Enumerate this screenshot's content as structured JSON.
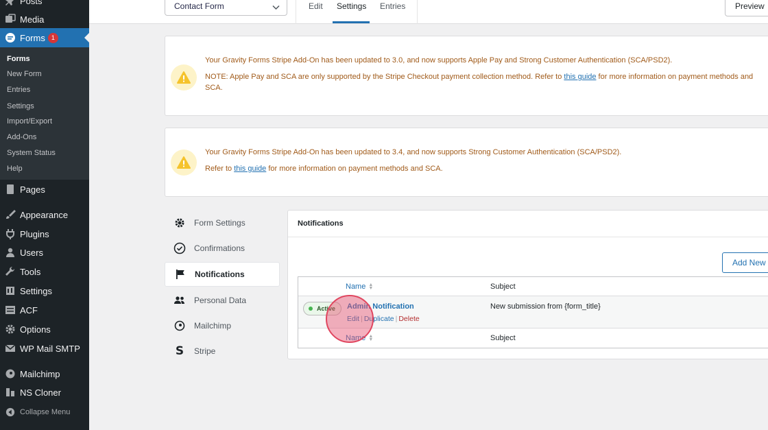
{
  "sidebar": {
    "items": [
      {
        "label": "Posts",
        "icon": "pin-icon"
      },
      {
        "label": "Media",
        "icon": "media-icon"
      },
      {
        "label": "Forms",
        "icon": "forms-icon",
        "badge": "1"
      },
      {
        "label": "Pages",
        "icon": "pages-icon"
      },
      {
        "label": "Appearance",
        "icon": "brush-icon"
      },
      {
        "label": "Plugins",
        "icon": "plugin-icon"
      },
      {
        "label": "Users",
        "icon": "user-icon"
      },
      {
        "label": "Tools",
        "icon": "wrench-icon"
      },
      {
        "label": "Settings",
        "icon": "settings-icon"
      },
      {
        "label": "ACF",
        "icon": "acf-icon"
      },
      {
        "label": "Options",
        "icon": "gear-icon"
      },
      {
        "label": "WP Mail SMTP",
        "icon": "mail-icon"
      },
      {
        "label": "Mailchimp",
        "icon": "mailchimp-icon"
      },
      {
        "label": "NS Cloner",
        "icon": "cloner-icon"
      },
      {
        "label": "Collapse Menu",
        "icon": "collapse-icon"
      }
    ],
    "submenu": [
      "Forms",
      "New Form",
      "Entries",
      "Settings",
      "Import/Export",
      "Add-Ons",
      "System Status",
      "Help"
    ]
  },
  "topbar": {
    "form_select": "Contact Form",
    "tabs": [
      "Edit",
      "Settings",
      "Entries"
    ],
    "preview": "Preview"
  },
  "notices": [
    {
      "line1": "Your Gravity Forms Stripe Add-On has been updated to 3.0, and now supports Apple Pay and Strong Customer Authentication (SCA/PSD2).",
      "line2_before": "NOTE: Apple Pay and SCA are only supported by the Stripe Checkout payment collection method. Refer to ",
      "line2_link": "this guide",
      "line2_after": " for more information on payment methods and SCA."
    },
    {
      "line1": "Your Gravity Forms Stripe Add-On has been updated to 3.4, and now supports Strong Customer Authentication (SCA/PSD2).",
      "line2_before": "Refer to ",
      "line2_link": "this guide",
      "line2_after": " for more information on payment methods and SCA."
    }
  ],
  "settings_nav": [
    {
      "label": "Form Settings",
      "icon": "gear-icon"
    },
    {
      "label": "Confirmations",
      "icon": "check-circle-icon"
    },
    {
      "label": "Notifications",
      "icon": "flag-icon"
    },
    {
      "label": "Personal Data",
      "icon": "people-icon"
    },
    {
      "label": "Mailchimp",
      "icon": "mailchimp-icon"
    },
    {
      "label": "Stripe",
      "icon": "stripe-icon"
    }
  ],
  "panel": {
    "title": "Notifications",
    "add_new": "Add New",
    "col_name": "Name",
    "col_subject": "Subject",
    "row": {
      "status": "Active",
      "name": "Admin Notification",
      "subject": "New submission from {form_title}",
      "actions": [
        "Edit",
        "Duplicate",
        "Delete"
      ]
    }
  },
  "colors": {
    "sidebar_bg": "#1d2327",
    "accent": "#2271b1",
    "notice_text": "#a05a19",
    "delete": "#b32d2e"
  }
}
